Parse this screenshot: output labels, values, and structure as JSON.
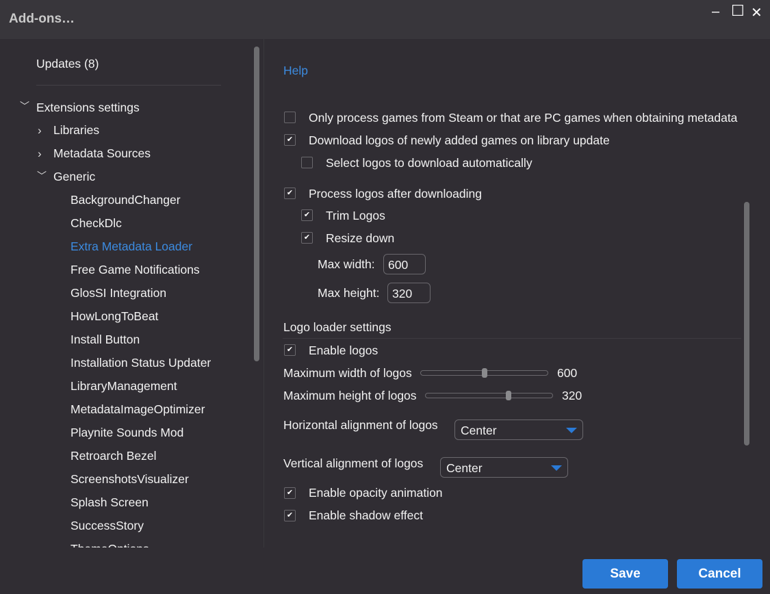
{
  "window": {
    "title": "Add-ons…",
    "minimize": "‒",
    "maximize": "☐",
    "close": "✕"
  },
  "sidebar": {
    "updates": "Updates (8)",
    "extensions_settings": "Extensions settings",
    "libraries": "Libraries",
    "metadata_sources": "Metadata Sources",
    "generic": "Generic",
    "generic_items": [
      "BackgroundChanger",
      "CheckDlc",
      "Extra Metadata Loader",
      "Free Game Notifications",
      "GlosSI Integration",
      "HowLongToBeat",
      "Install Button",
      "Installation Status Updater",
      "LibraryManagement",
      "MetadataImageOptimizer",
      "Playnite Sounds Mod",
      "Retroarch Bezel",
      "ScreenshotsVisualizer",
      "Splash Screen",
      "SuccessStory",
      "ThemeOptions"
    ],
    "selected": "Extra Metadata Loader"
  },
  "settings": {
    "help": "Help",
    "only_steam": {
      "label": "Only process games from Steam or that are PC games when obtaining metadata",
      "checked": false
    },
    "download_logos": {
      "label": "Download logos of newly added games on library update",
      "checked": true
    },
    "select_logos": {
      "label": "Select logos to download automatically",
      "checked": false
    },
    "process_logos": {
      "label": "Process logos after downloading",
      "checked": true
    },
    "trim_logos": {
      "label": "Trim Logos",
      "checked": true
    },
    "resize_down": {
      "label": "Resize down",
      "checked": true
    },
    "max_width_label": "Max width:",
    "max_width_value": "600",
    "max_height_label": "Max height:",
    "max_height_value": "320",
    "logo_loader_header": "Logo loader settings",
    "enable_logos": {
      "label": "Enable logos",
      "checked": true
    },
    "max_width_logos": {
      "label": "Maximum width of logos",
      "value": "600",
      "fraction": 0.5
    },
    "max_height_logos": {
      "label": "Maximum height of logos",
      "value": "320",
      "fraction": 0.66
    },
    "horizontal_alignment": {
      "label": "Horizontal alignment of logos",
      "value": "Center"
    },
    "vertical_alignment": {
      "label": "Vertical alignment of logos",
      "value": "Center"
    },
    "opacity_animation": {
      "label": "Enable opacity animation",
      "checked": true
    },
    "shadow_effect": {
      "label": "Enable shadow effect",
      "checked": true
    }
  },
  "buttons": {
    "save": "Save",
    "cancel": "Cancel"
  },
  "colors": {
    "accent": "#2a7ad6",
    "link": "#3c8be0",
    "background": "#302d33"
  }
}
